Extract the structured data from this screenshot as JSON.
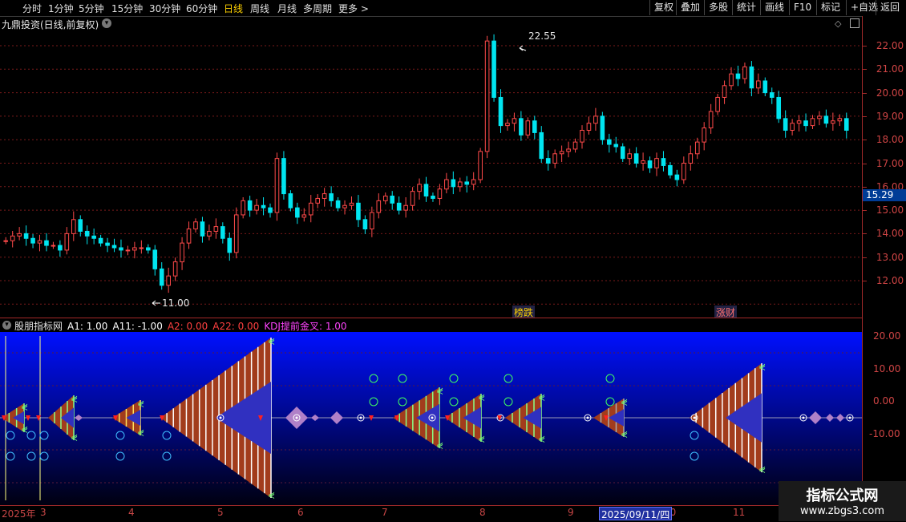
{
  "toolbar": {
    "periods": [
      "分时",
      "1分钟",
      "5分钟",
      "15分钟",
      "30分钟",
      "60分钟",
      "日线",
      "周线",
      "月线",
      "多周期",
      "更多 >"
    ],
    "active_period": "日线",
    "right_buttons": [
      "复权",
      "叠加",
      "多股",
      "统计",
      "画线",
      "F10",
      "标记",
      "+自选",
      "返回"
    ]
  },
  "main_chart": {
    "title": "九鼎投资(日线,前复权)",
    "high_label": "22.55",
    "low_label": "11.00",
    "current_price": "15.29",
    "event_tags": [
      "榜跌",
      "涨财"
    ],
    "y_ticks": [
      "22.00",
      "21.00",
      "20.00",
      "19.00",
      "18.00",
      "17.00",
      "16.00",
      "15.00",
      "14.00",
      "13.00",
      "12.00"
    ]
  },
  "indicator": {
    "name": "股朋指标网",
    "params": [
      {
        "label": "A1: 1.00",
        "color": "#ffffff"
      },
      {
        "label": "A11: -1.00",
        "color": "#ffffff"
      },
      {
        "label": "A2: 0.00",
        "color": "#ff4040"
      },
      {
        "label": "A22: 0.00",
        "color": "#ff4040"
      },
      {
        "label": "KDJ提前金叉: 1.00",
        "color": "#ff44ff"
      }
    ],
    "y_ticks": [
      "20.00",
      "10.00",
      "0.00",
      "-10.00"
    ]
  },
  "date_axis": {
    "year_label": "2025年",
    "months": [
      "3",
      "4",
      "5",
      "6",
      "7",
      "8",
      "9",
      "10",
      "11"
    ],
    "cursor_date": "2025/09/11/四"
  },
  "watermark": {
    "line1": "指标公式网",
    "line2": "www.zbgs3.com"
  },
  "chart_data": {
    "type": "candlestick",
    "y_range": [
      11.0,
      22.8
    ],
    "close": [
      13.7,
      13.9,
      14.0,
      13.8,
      13.6,
      13.7,
      13.5,
      13.5,
      13.3,
      14.0,
      14.6,
      14.1,
      13.9,
      13.8,
      13.6,
      13.5,
      13.4,
      13.3,
      13.3,
      13.4,
      13.4,
      13.3,
      12.5,
      11.8,
      12.2,
      12.8,
      13.6,
      14.2,
      14.5,
      13.9,
      14.1,
      14.3,
      13.8,
      13.2,
      14.8,
      15.4,
      15.0,
      15.2,
      15.1,
      14.9,
      17.2,
      15.7,
      15.1,
      14.7,
      14.8,
      15.3,
      15.5,
      15.7,
      15.4,
      15.1,
      15.2,
      15.3,
      14.6,
      14.2,
      14.9,
      15.4,
      15.6,
      15.3,
      15.0,
      15.2,
      15.8,
      16.1,
      15.6,
      15.5,
      15.9,
      16.3,
      16.0,
      16.2,
      16.1,
      16.3,
      17.5,
      22.2,
      19.8,
      18.6,
      18.7,
      18.9,
      18.2,
      18.8,
      18.3,
      17.2,
      17.0,
      17.4,
      17.5,
      17.6,
      17.9,
      18.4,
      18.7,
      19.0,
      18.0,
      17.8,
      17.7,
      17.2,
      17.4,
      17.0,
      17.1,
      16.8,
      17.2,
      16.9,
      16.5,
      16.3,
      17.0,
      17.4,
      17.9,
      18.5,
      19.2,
      19.8,
      20.3,
      20.8,
      20.6,
      21.1,
      20.2,
      20.5,
      20.0,
      19.8,
      18.9,
      18.4,
      18.7,
      18.8,
      18.6,
      18.9,
      19.0,
      18.7,
      18.8,
      18.9,
      18.4
    ]
  }
}
